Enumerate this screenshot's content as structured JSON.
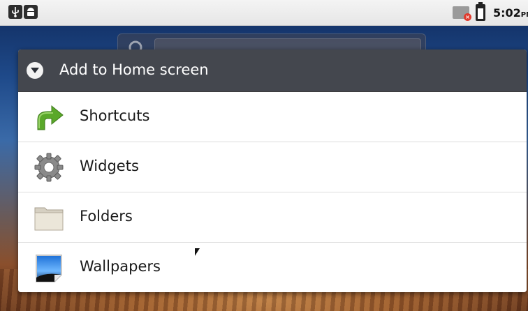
{
  "status_bar": {
    "left_icons": [
      "usb-icon",
      "android-debug-icon"
    ],
    "right_icons": [
      "no-sim-icon",
      "battery-icon"
    ],
    "time": "5:02",
    "ampm": "PM"
  },
  "background": {
    "search_widget_icon": "search-icon"
  },
  "dialog": {
    "title": "Add to Home screen",
    "title_icon": "chevron-down-circle-icon",
    "items": [
      {
        "label": "Shortcuts",
        "icon": "green-arrow-shortcut-icon"
      },
      {
        "label": "Widgets",
        "icon": "gear-widget-icon"
      },
      {
        "label": "Folders",
        "icon": "folder-icon"
      },
      {
        "label": "Wallpapers",
        "icon": "wallpaper-picture-icon"
      }
    ]
  },
  "colors": {
    "header_bg": "#2a2e36",
    "shortcut_green": "#5aa82a",
    "wallpaper_blue": "#1f4a8a"
  }
}
